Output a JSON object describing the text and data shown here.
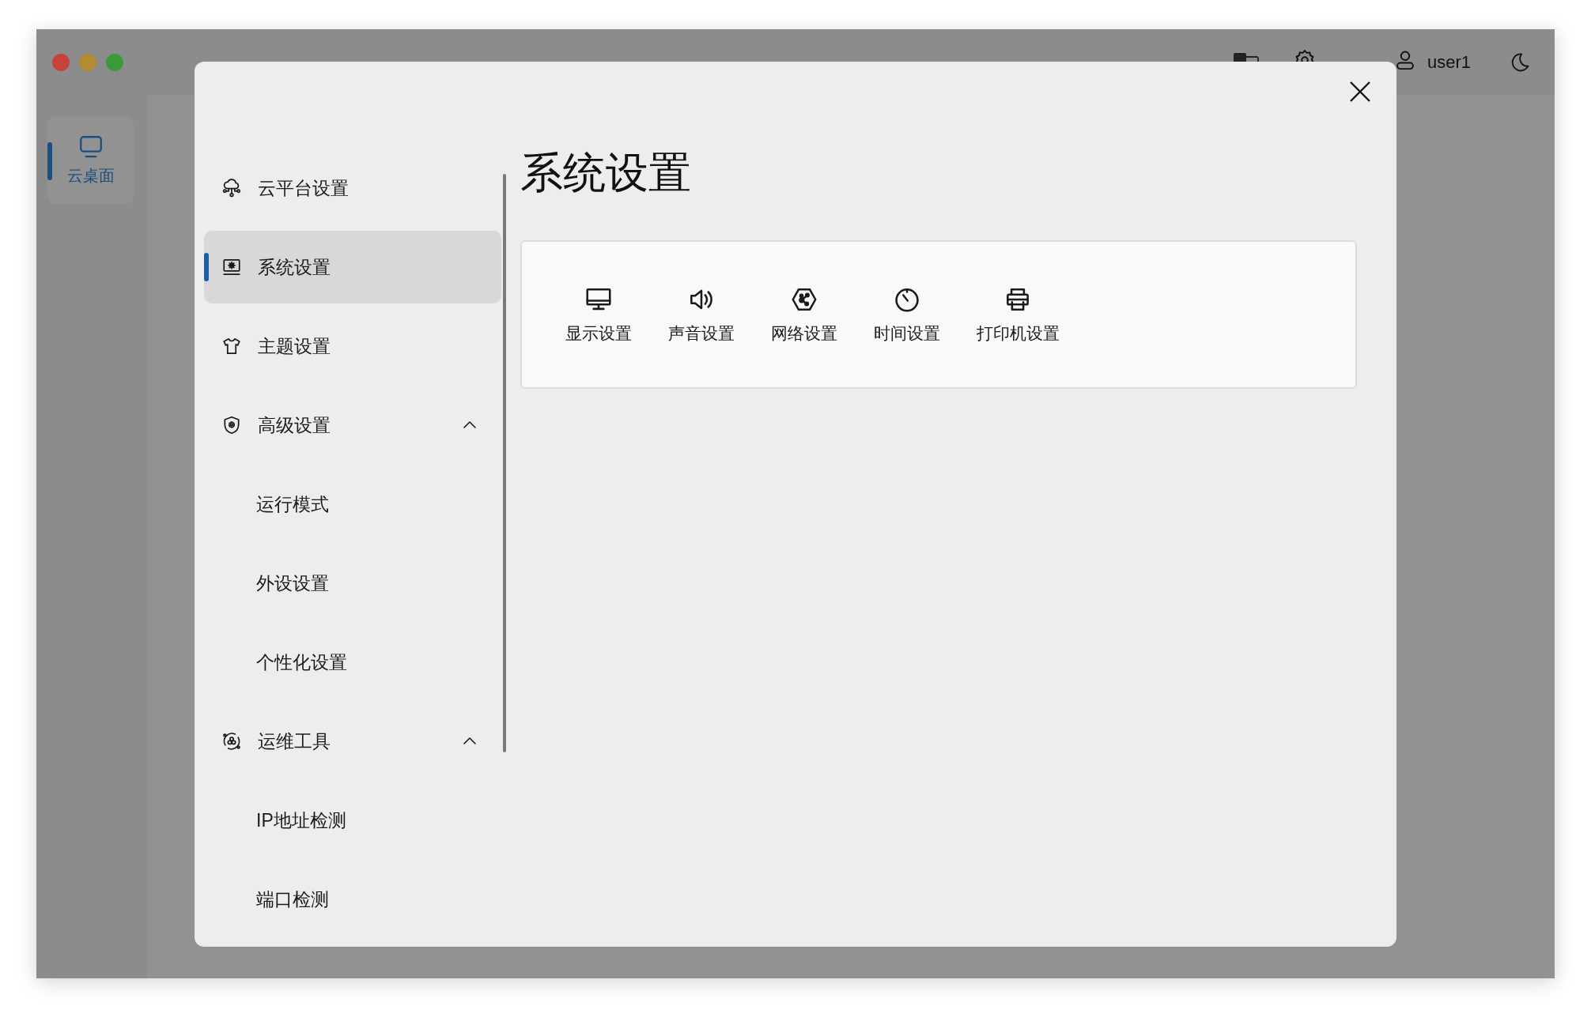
{
  "top_bar": {
    "user_name": "user1"
  },
  "sidebar": {
    "items": [
      {
        "label": "云桌面",
        "selected": true
      }
    ]
  },
  "dialog": {
    "title": "系统设置",
    "menu": [
      {
        "label": "云平台设置",
        "selected": false
      },
      {
        "label": "系统设置",
        "selected": true
      },
      {
        "label": "主题设置",
        "selected": false
      },
      {
        "label": "高级设置",
        "selected": false,
        "expanded": true,
        "children": [
          {
            "label": "运行模式",
            "selected": false
          },
          {
            "label": "外设设置",
            "selected": false
          },
          {
            "label": "个性化设置",
            "selected": false
          }
        ]
      },
      {
        "label": "运维工具",
        "selected": false,
        "expanded": true,
        "children": [
          {
            "label": "IP地址检测",
            "selected": false
          },
          {
            "label": "端口检测",
            "selected": false
          }
        ]
      }
    ],
    "tiles": [
      {
        "label": "显示设置"
      },
      {
        "label": "声音设置"
      },
      {
        "label": "网络设置"
      },
      {
        "label": "时间设置"
      },
      {
        "label": "打印机设置"
      }
    ]
  }
}
